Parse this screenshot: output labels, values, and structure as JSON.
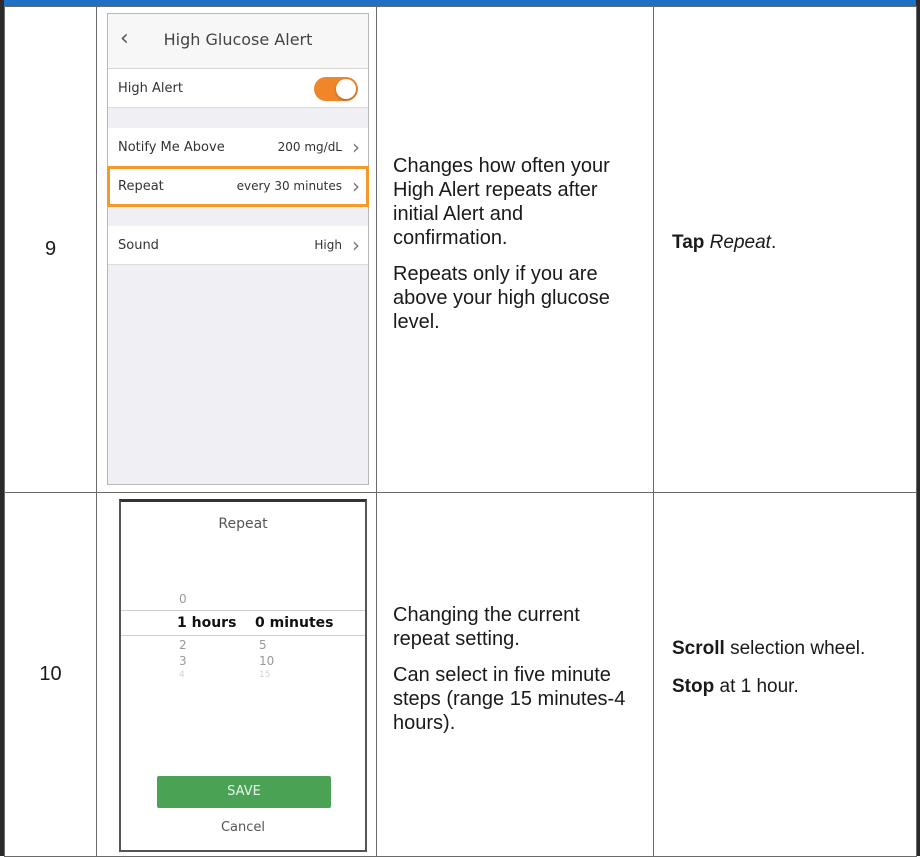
{
  "steps": [
    {
      "number": "9",
      "screen": {
        "title": "High Glucose Alert",
        "back_icon": "chevron-left-icon",
        "rows": [
          {
            "label": "High Alert",
            "type": "toggle",
            "on": true
          },
          {
            "label": "Notify Me Above",
            "value": "200 mg/dL"
          },
          {
            "label": "Repeat",
            "value": "every 30 minutes",
            "highlighted": true
          },
          {
            "label": "Sound",
            "value": "High"
          }
        ]
      },
      "description": [
        "Changes how often your High Alert repeats after initial Alert and confirmation.",
        "Repeats only if you are above your high glucose level."
      ],
      "action": {
        "verb": "Tap",
        "object": "Repeat"
      }
    },
    {
      "number": "10",
      "screen": {
        "title": "Repeat",
        "wheel": {
          "above": {
            "hours": "0"
          },
          "selected": {
            "hours": "1",
            "hours_unit": "hours",
            "minutes": "0",
            "minutes_unit": "minutes"
          },
          "below1": {
            "hours": "2",
            "minutes": "5"
          },
          "below2": {
            "hours": "3",
            "minutes": "10"
          },
          "below3": {
            "hours": "4",
            "minutes": "15"
          }
        },
        "save_label": "SAVE",
        "cancel_label": "Cancel"
      },
      "description": [
        "Changing the current repeat setting.",
        "Can select in five minute steps (range 15 minutes-4 hours)."
      ],
      "action": {
        "line1_verb": "Scroll",
        "line1_rest": "selection wheel.",
        "line2_verb": "Stop",
        "line2_rest": "at 1 hour."
      }
    }
  ],
  "colors": {
    "highlight": "#f39a2a",
    "toggle_on": "#f0852a",
    "save_button": "#4aa355",
    "header_bar": "#1f6fc4"
  }
}
